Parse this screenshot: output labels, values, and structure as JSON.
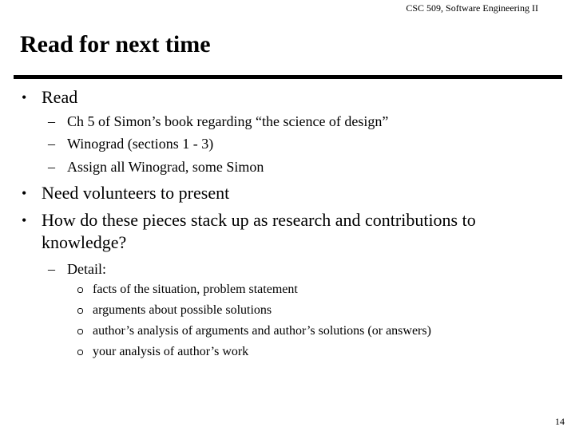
{
  "header": {
    "course": "CSC 509, Software Engineering II"
  },
  "slide": {
    "title": "Read for next time",
    "page_number": "14",
    "bullets": [
      {
        "text": "Read",
        "sub": [
          "Ch 5 of Simon’s book regarding “the science of design”",
          "Winograd (sections 1 - 3)",
          "Assign all Winograd, some Simon"
        ]
      },
      {
        "text": "Need volunteers to present"
      },
      {
        "text_line1": "How do these pieces stack up as research and contributions to",
        "text_line2": "knowledge?",
        "sub": [
          {
            "text": "Detail:",
            "sub": [
              "facts of the situation, problem statement",
              "arguments about possible solutions",
              "author’s analysis of arguments and author’s solutions (or answers)",
              "your analysis of author’s work"
            ]
          }
        ]
      }
    ],
    "bullet_glyph": "•",
    "dash_glyph": "–"
  }
}
